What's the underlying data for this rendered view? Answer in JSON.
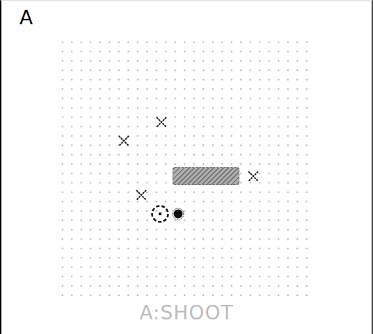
{
  "title": "A",
  "hint": "A:SHOOT",
  "enemies": [
    {
      "x": 10.5,
      "y": 8.5
    },
    {
      "x": 6.5,
      "y": 10.5
    },
    {
      "x": 20.3,
      "y": 14.3
    },
    {
      "x": 8.4,
      "y": 16.3
    }
  ],
  "barrier": {
    "x": 11.7,
    "y": 13.3,
    "w": 7.1,
    "h": 1.9
  },
  "player": {
    "x": 10.4,
    "y": 18.3
  },
  "ball": {
    "x": 12.3,
    "y": 18.3
  }
}
